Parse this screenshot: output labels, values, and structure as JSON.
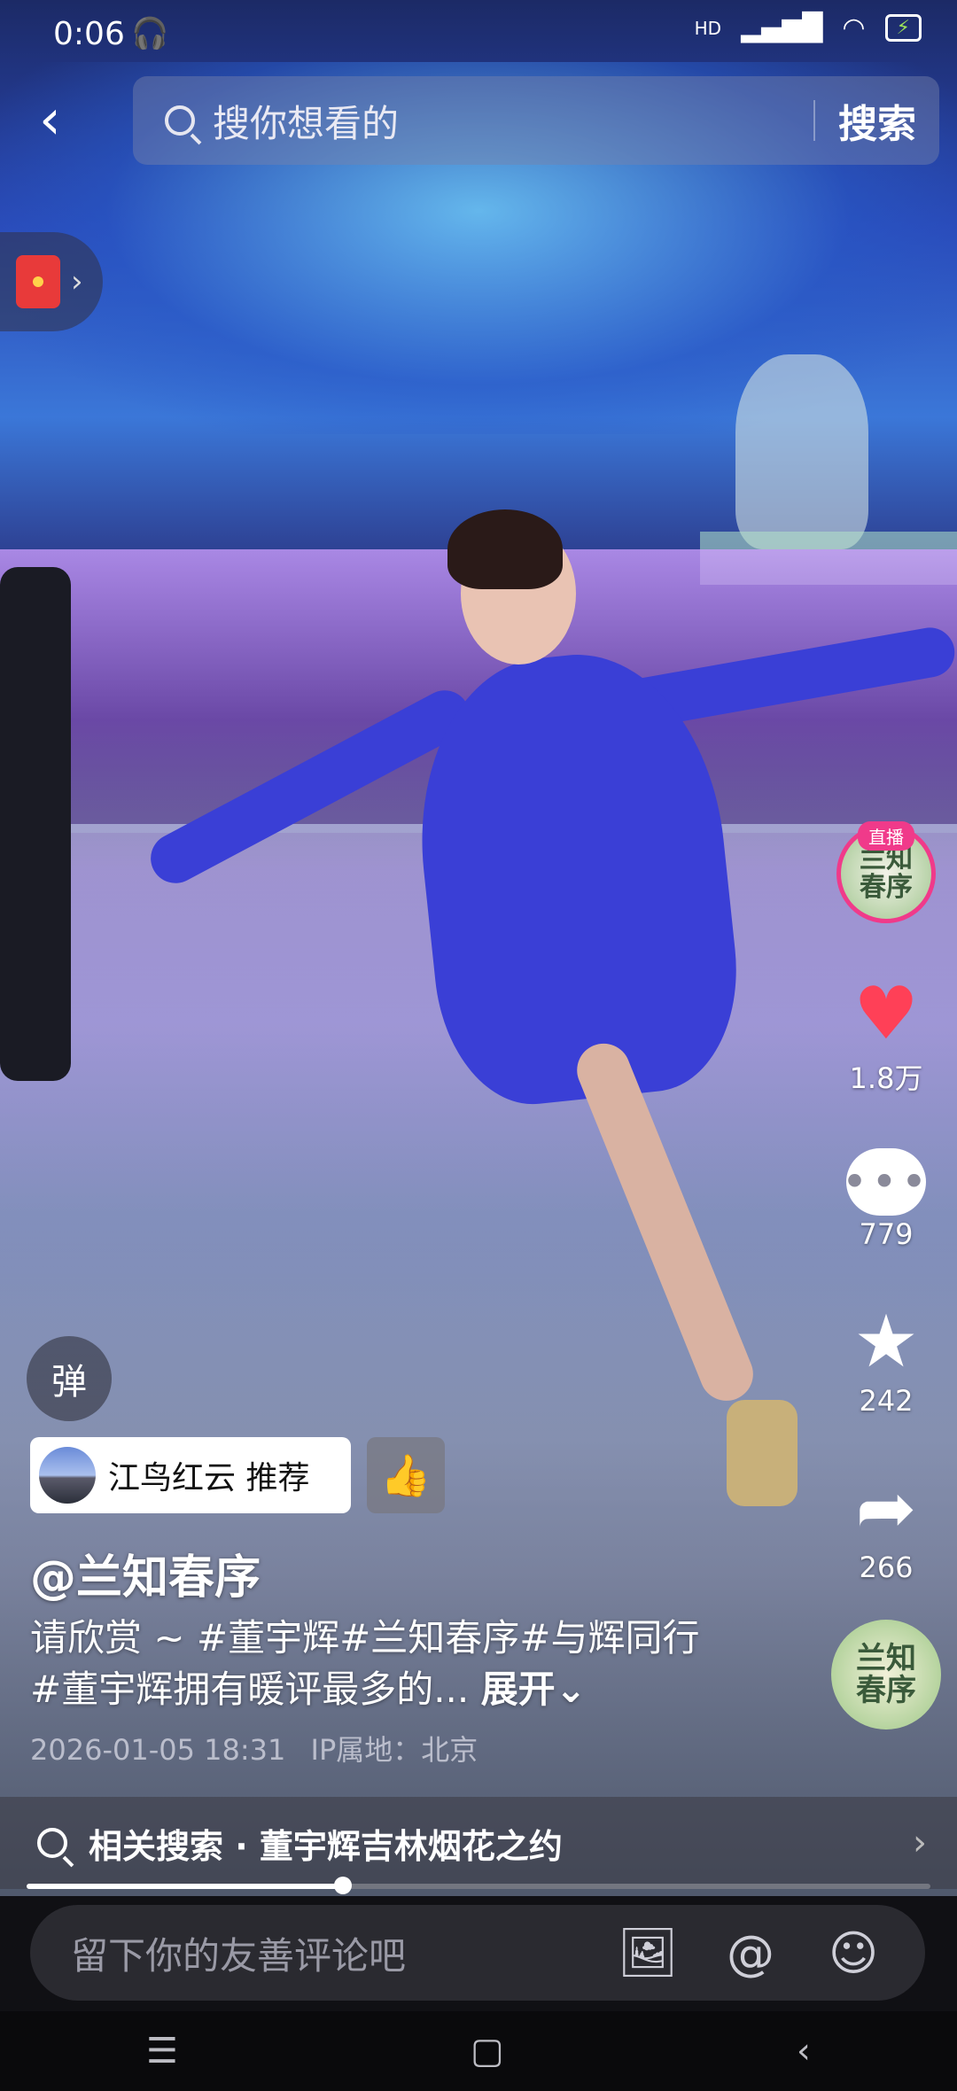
{
  "status_bar": {
    "time": "0:06",
    "hp_label": "HD",
    "icons": [
      "headphones-icon",
      "signal-icon",
      "wifi-icon",
      "battery-charging-icon"
    ]
  },
  "search": {
    "placeholder": "搜你想看的",
    "button_label": "搜索"
  },
  "author": {
    "handle": "@兰知春序",
    "live_badge": "直播",
    "avatar_text": "兰知春序"
  },
  "actions": {
    "likes": "1.8万",
    "comments": "779",
    "favorites": "242",
    "shares": "266"
  },
  "recommend": {
    "label": "江鸟红云 推荐"
  },
  "danmu": {
    "label": "弹"
  },
  "description": {
    "text": "请欣赏 ~ #董宇辉#兰知春序#与辉同行#董宇辉拥有暖评最多的...",
    "more": "展开"
  },
  "meta": {
    "datetime": "2026-01-05 18:31",
    "ip": "IP属地：北京"
  },
  "related_search": {
    "text": "相关搜索 · 董宇辉吉林烟花之约"
  },
  "playback": {
    "progress": 0.35
  },
  "comment_bar": {
    "placeholder": "留下你的友善评论吧"
  },
  "colors": {
    "like_red": "#ff4057",
    "live_pink": "#f03a8a"
  }
}
